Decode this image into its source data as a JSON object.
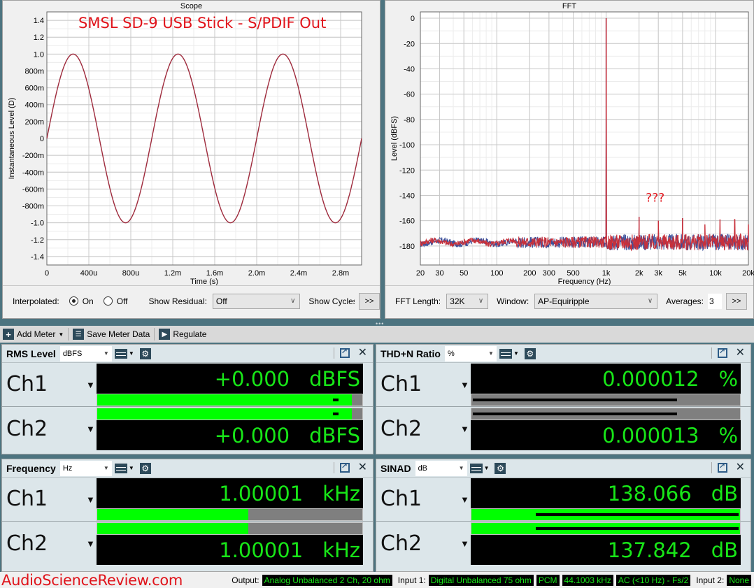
{
  "scope": {
    "title": "Scope",
    "annotation": "SMSL SD-9 USB Stick - S/PDIF Out",
    "controls": {
      "interpolated_label": "Interpolated:",
      "on_label": "On",
      "off_label": "Off",
      "interpolated_selected": "On",
      "show_residual_label": "Show Residual:",
      "show_residual_value": "Off",
      "show_cycles_label": "Show Cycles",
      "more_label": ">>"
    }
  },
  "fft": {
    "title": "FFT",
    "annotation": "???",
    "controls": {
      "fft_length_label": "FFT Length:",
      "fft_length_value": "32K",
      "window_label": "Window:",
      "window_value": "AP-Equiripple",
      "averages_label": "Averages:",
      "averages_value": "3",
      "more_label": ">>"
    }
  },
  "chart_data": [
    {
      "type": "line",
      "title": "Scope",
      "xlabel": "Time (s)",
      "ylabel": "Instantaneous Level (D)",
      "xlim": [
        0,
        0.003
      ],
      "ylim": [
        -1.5,
        1.5
      ],
      "x_ticks": [
        0,
        0.0004,
        0.0008,
        0.0012,
        0.0016,
        0.002,
        0.0024,
        0.0028
      ],
      "x_tick_labels": [
        "0",
        "400u",
        "800u",
        "1.2m",
        "1.6m",
        "2.0m",
        "2.4m",
        "2.8m"
      ],
      "y_ticks": [
        1.4,
        1.2,
        1.0,
        0.8,
        0.6,
        0.4,
        0.2,
        0,
        -0.2,
        -0.4,
        -0.6,
        -0.8,
        -1.0,
        -1.2,
        -1.4
      ],
      "y_tick_labels": [
        "1.4",
        "1.2",
        "1.0",
        "800m",
        "600m",
        "400m",
        "200m",
        "0",
        "-200m",
        "-400m",
        "-600m",
        "-800m",
        "-1.0",
        "-1.2",
        "-1.4"
      ],
      "grid": true,
      "series": [
        {
          "name": "Ch1",
          "color": "#9e2a3c",
          "function": "sine",
          "frequency_hz": 1000,
          "amplitude": 1.0,
          "phase": 0
        }
      ]
    },
    {
      "type": "line",
      "title": "FFT",
      "xlabel": "Frequency (Hz)",
      "ylabel": "Level (dBFS)",
      "xscale": "log",
      "xlim": [
        20,
        20000
      ],
      "ylim": [
        -195,
        5
      ],
      "x_ticks": [
        20,
        30,
        50,
        100,
        200,
        300,
        500,
        1000,
        2000,
        3000,
        5000,
        10000,
        20000
      ],
      "x_tick_labels": [
        "20",
        "30",
        "50",
        "100",
        "200",
        "300",
        "500",
        "1k",
        "2k",
        "3k",
        "5k",
        "10k",
        "20k"
      ],
      "y_ticks": [
        0,
        -20,
        -40,
        -60,
        -80,
        -100,
        -120,
        -140,
        -160,
        -180
      ],
      "y_tick_labels": [
        "0",
        "-20",
        "-40",
        "-60",
        "-80",
        "-100",
        "-120",
        "-140",
        "-160",
        "-180"
      ],
      "grid": true,
      "noise_floor_dbfs": -177,
      "series": [
        {
          "name": "Ch1",
          "color": "#3b4f9a",
          "peaks": [
            {
              "x": 1000,
              "y": 0
            },
            {
              "x": 2000,
              "y": -157
            },
            {
              "x": 3000,
              "y": -160
            },
            {
              "x": 5000,
              "y": -158
            }
          ]
        },
        {
          "name": "Ch2",
          "color": "#c8303a",
          "peaks": [
            {
              "x": 1000,
              "y": 0
            },
            {
              "x": 2000,
              "y": -157
            },
            {
              "x": 3000,
              "y": -160
            },
            {
              "x": 5000,
              "y": -158
            },
            {
              "x": 8000,
              "y": -163
            },
            {
              "x": 11000,
              "y": -159
            },
            {
              "x": 15000,
              "y": -159
            },
            {
              "x": 20000,
              "y": -163
            }
          ]
        }
      ]
    }
  ],
  "toolbar": {
    "add_meter": "Add Meter",
    "save_meter_data": "Save Meter Data",
    "regulate": "Regulate"
  },
  "meters": {
    "rms": {
      "name": "RMS Level",
      "unit": "dBFS",
      "ch1": {
        "label": "Ch1",
        "value": "+0.000",
        "unit": "dBFS",
        "bar_fraction": 0.96,
        "peak_fraction": 0.94
      },
      "ch2": {
        "label": "Ch2",
        "value": "+0.000",
        "unit": "dBFS",
        "bar_fraction": 0.96,
        "peak_fraction": 0.94
      }
    },
    "thdn": {
      "name": "THD+N Ratio",
      "unit": "%",
      "ch1": {
        "label": "Ch1",
        "value": "0.000012",
        "unit": "%",
        "bar_fraction": 0.0,
        "peak_fraction": 0.76
      },
      "ch2": {
        "label": "Ch2",
        "value": "0.000013",
        "unit": "%",
        "bar_fraction": 0.0,
        "peak_fraction": 0.76
      }
    },
    "freq": {
      "name": "Frequency",
      "unit": "Hz",
      "ch1": {
        "label": "Ch1",
        "value": "1.00001",
        "unit": "kHz",
        "bar_fraction": 0.57,
        "peak_fraction": 0
      },
      "ch2": {
        "label": "Ch2",
        "value": "1.00001",
        "unit": "kHz",
        "bar_fraction": 0.57,
        "peak_fraction": 0
      }
    },
    "sinad": {
      "name": "SINAD",
      "unit": "dB",
      "ch1": {
        "label": "Ch1",
        "value": "138.066",
        "unit": "dB",
        "bar_fraction": 1.0,
        "peak_fraction": 1.0
      },
      "ch2": {
        "label": "Ch2",
        "value": "137.842",
        "unit": "dB",
        "bar_fraction": 1.0,
        "peak_fraction": 1.0
      }
    }
  },
  "status": {
    "brand": "AudioScienceReview.com",
    "output_label": "Output:",
    "output_value": "Analog Unbalanced 2 Ch, 20 ohm",
    "input1_label": "Input 1:",
    "input1_value": "Digital Unbalanced 75 ohm",
    "format_value": "PCM",
    "rate_value": "44.1003 kHz",
    "coupling_value": "AC (<10 Hz) - Fs/2",
    "input2_label": "Input 2:",
    "input2_value": "None"
  },
  "colors": {
    "accent_green": "#18e618",
    "bar_green": "#00ff00",
    "annotation_red": "#e0131a",
    "scope_trace": "#9e2a3c",
    "fft_ch1": "#3b4f9a",
    "fft_ch2": "#c8303a"
  }
}
